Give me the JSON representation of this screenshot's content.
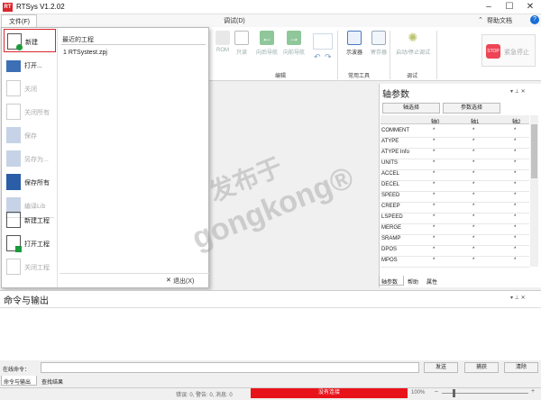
{
  "window": {
    "title": "RTSys V1.2.02",
    "app_icon": "RT"
  },
  "menu": {
    "file": "文件(F)",
    "debug": "调试(D)",
    "help": "帮助文档"
  },
  "ribbon": {
    "buttons": [
      "ROM",
      "只读",
      "向后导航",
      "向前导航",
      "示波器",
      "寄存器",
      "启动/停止调试",
      "紧急停止"
    ],
    "groups": [
      "编辑",
      "常用工具",
      "调试"
    ]
  },
  "file_menu": {
    "items": [
      {
        "label": "新建",
        "disabled": false
      },
      {
        "label": "打开...",
        "disabled": false
      },
      {
        "label": "关闭",
        "disabled": true
      },
      {
        "label": "关闭所有",
        "disabled": true
      },
      {
        "label": "保存",
        "disabled": true
      },
      {
        "label": "另存为...",
        "disabled": true
      },
      {
        "label": "保存所有",
        "disabled": false
      },
      {
        "label": "编译Lib",
        "disabled": true
      },
      {
        "label": "新建工程",
        "disabled": false
      },
      {
        "label": "打开工程",
        "disabled": false
      },
      {
        "label": "关闭工程",
        "disabled": true
      }
    ],
    "recent_title": "最近的工程",
    "recent": [
      "1 RTSystest.zpj"
    ],
    "exit": "退出(X)"
  },
  "axis_panel": {
    "title": "轴参数",
    "axis_select": "轴选择",
    "param_select": "参数选择",
    "columns": [
      "轴0",
      "轴1",
      "轴2"
    ],
    "rows": [
      "COMMENT",
      "ATYPE",
      "ATYPE Info",
      "UNITS",
      "ACCEL",
      "DECEL",
      "SPEED",
      "CREEP",
      "LSPEED",
      "MERGE",
      "SRAMP",
      "DPOS",
      "MPOS"
    ],
    "cell_value": "*",
    "tabs": [
      "轴参数",
      "帮助",
      "属性"
    ]
  },
  "command": {
    "title": "命令与输出",
    "online_label": "在线命令：",
    "send": "发送",
    "capture": "捕获",
    "clear": "清除",
    "tabs": [
      "命令与输出",
      "查找结果"
    ]
  },
  "status": {
    "counts": "错误: 0, 警告: 0, 消息: 0",
    "connection": "没有连接",
    "zoom": "100%"
  },
  "watermark": {
    "line1": "发布于",
    "line2": "gongkong®"
  }
}
